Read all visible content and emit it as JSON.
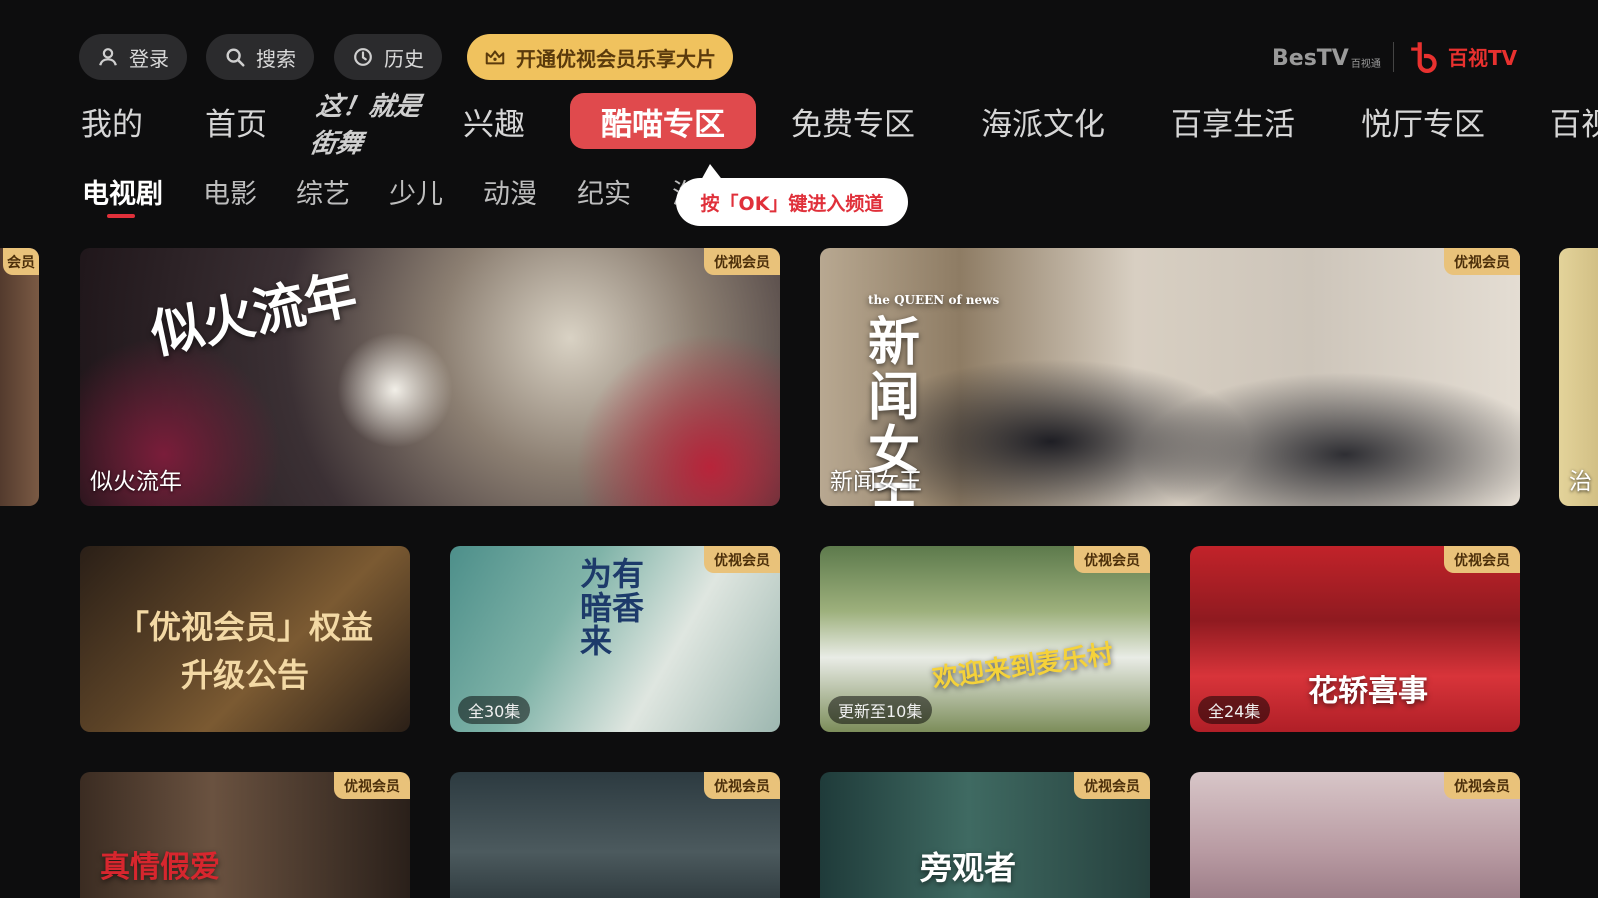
{
  "top_bar": {
    "login_label": "登录",
    "search_label": "搜索",
    "history_label": "历史",
    "vip_label": "开通优视会员乐享大片",
    "bestv_logo": "BesTV",
    "bestv_sub": "百视通",
    "brand_logo": "百视TV"
  },
  "nav": {
    "items": [
      "我的",
      "首页",
      "兴趣",
      "酷喵专区",
      "免费专区",
      "海派文化",
      "百享生活",
      "悦厅专区",
      "百视"
    ],
    "show_logo": "这！就是街舞",
    "active": "酷喵专区"
  },
  "sub_tabs": {
    "items": [
      "电视剧",
      "电影",
      "综艺",
      "少儿",
      "动漫",
      "纪实",
      "海"
    ],
    "active": "电视剧"
  },
  "tooltip": "按「OK」键进入频道",
  "badge_label": "优视会员",
  "edge_badge": "会员",
  "cards_row1": [
    {
      "title": "似火流年",
      "poster": "似火流年"
    },
    {
      "title": "新闻女王",
      "poster_en": "the QUEEN of news",
      "poster": "新闻女王"
    },
    {
      "title": "治"
    }
  ],
  "notice": {
    "line1": "「优视会员」权益",
    "line2": "升级公告"
  },
  "cards_row2": [
    {
      "episodes": "全30集",
      "poster": "为有暗香来"
    },
    {
      "episodes": "更新至10集",
      "poster": "欢迎来到麦乐村"
    },
    {
      "episodes": "全24集",
      "poster": "花轿喜事"
    }
  ],
  "cards_row3": [
    {
      "poster": "真情假爱"
    },
    {
      "poster": ""
    },
    {
      "poster": "旁观者"
    },
    {
      "poster": ""
    }
  ],
  "colors": {
    "background": "#0d0d0e",
    "accent_red": "#e04a4d",
    "vip_gold": "#f0c25e",
    "badge_gold": "#e9c27a"
  }
}
